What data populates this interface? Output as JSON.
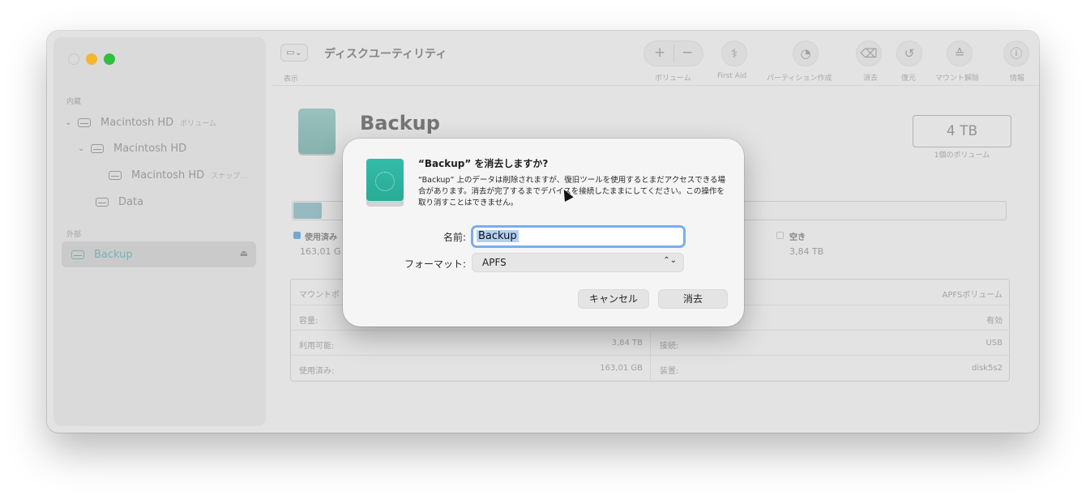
{
  "app": {
    "title": "ディスクユーティリティ",
    "view_label": "表示"
  },
  "toolbar": {
    "items": [
      {
        "label": "ボリューム",
        "icon": "plus-minus-icon"
      },
      {
        "label": "First Aid",
        "icon": "stethoscope-icon"
      },
      {
        "label": "パーティション作成",
        "icon": "pie-chart-icon"
      },
      {
        "label": "消去",
        "icon": "eraser-icon"
      },
      {
        "label": "復元",
        "icon": "restore-icon"
      },
      {
        "label": "マウント解除",
        "icon": "unmount-icon"
      },
      {
        "label": "情報",
        "icon": "info-icon"
      }
    ]
  },
  "sidebar": {
    "section_internal": "内蔵",
    "section_external": "外部",
    "items": [
      {
        "label": "Macintosh HD",
        "sub": "ボリューム"
      },
      {
        "label": "Macintosh HD",
        "sub": ""
      },
      {
        "label": "Macintosh HD",
        "sub": "スナップ…"
      },
      {
        "label": "Data",
        "sub": ""
      },
      {
        "label": "Backup",
        "sub": ""
      }
    ]
  },
  "disk": {
    "name": "Backup",
    "capacity": "4 TB",
    "capacity_sub": "1個のボリューム",
    "used_fraction": 0.04,
    "legend_used": "使用済み",
    "legend_used_value": "163,01 G",
    "legend_free": "空き",
    "legend_free_value": "3,84 TB"
  },
  "info_table": {
    "rows": [
      {
        "l": "マウントポ",
        "lv": "",
        "r": "",
        "rv": "APFSボリューム"
      },
      {
        "l": "容量:",
        "lv": "",
        "r": "",
        "rv": "有効"
      },
      {
        "l": "利用可能:",
        "lv": "3,84 TB",
        "r": "接続:",
        "rv": "USB"
      },
      {
        "l": "使用済み:",
        "lv": "163,01 GB",
        "r": "装置:",
        "rv": "disk5s2"
      }
    ]
  },
  "dialog": {
    "title": "“Backup” を消去しますか?",
    "message": "“Backup” 上のデータは削除されますが、復旧ツールを使用するとまだアクセスできる場合があります。消去が完了するまでデバイスを接続したままにしてください。この操作を取り消すことはできません。",
    "name_label": "名前:",
    "name_value": "Backup",
    "format_label": "フォーマット:",
    "format_value": "APFS",
    "cancel_label": "キャンセル",
    "erase_label": "消去"
  },
  "colors": {
    "accent": "#79aef0",
    "disk_teal": "#2fb6a3"
  }
}
